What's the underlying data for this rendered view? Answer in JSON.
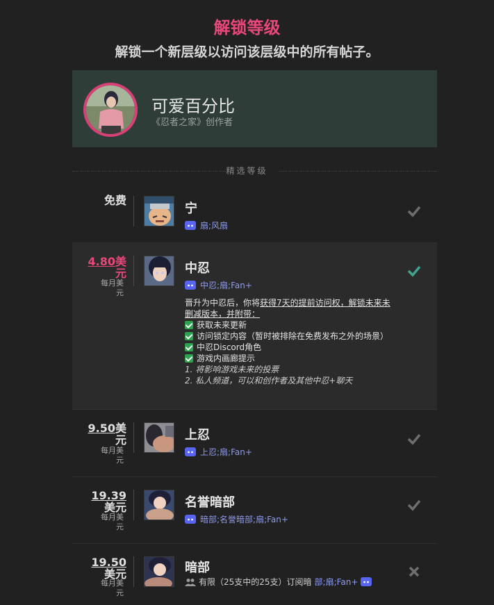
{
  "header": {
    "title": "解锁等级",
    "subtitle": "解锁一个新层级以访问该层级中的所有帖子。"
  },
  "creator": {
    "name": "可爱百分比",
    "description": "《忍者之家》创作者"
  },
  "divider_label": "精选等级",
  "colors": {
    "accent_pink": "#e8487a",
    "card_bg": "#2f3d39",
    "discord_blue": "#8e9bf0",
    "check_teal": "#3fa38f",
    "check_gray": "#6e6e6e"
  },
  "tiers": [
    {
      "price": "免费",
      "period": "",
      "name": "宁",
      "perk": "扇;风扇",
      "status": "check-gray"
    },
    {
      "price_num": "4.80",
      "price_unit": "美",
      "price_line2": "元",
      "period_line1": "每月美",
      "period_line2": "元",
      "name": "中忍",
      "perk": "中忍;扇;Fan+",
      "status": "check-teal",
      "description": {
        "intro_a": "晋升为中忍后，你将",
        "intro_b": "获得7天的提前访问权，解锁未来未删减版本，并附带：",
        "items": [
          "获取未来更新",
          "访问锁定内容（暂时被排除在免费发布之外的场景）",
          "中忍Discord角色",
          "游戏内画廊提示"
        ],
        "numbered": [
          "1. 将影响游戏未来的投票",
          "2. 私人频道，可以和创作者及其他中忍+聊天"
        ]
      }
    },
    {
      "price_num": "9.50",
      "price_unit": "美",
      "price_line2": "元",
      "period_line1": "每月美",
      "period_line2": "元",
      "name": "上忍",
      "perk": "上忍;扇;Fan+",
      "status": "check-gray"
    },
    {
      "price_num": "19.39",
      "price_line2": "美元",
      "period_line1": "每月美",
      "period_line2": "元",
      "name": "名誉暗部",
      "perk": "暗部;名誉暗部;扇;Fan+",
      "status": "check-gray"
    },
    {
      "price_num": "19.50",
      "price_line2": "美元",
      "period_line1": "每月美",
      "period_line2": "元",
      "name": "暗部",
      "limited_a": "有限（25支中的25支）订阅暗",
      "limited_b": "部;扇;Fan+",
      "status": "x-gray"
    }
  ]
}
